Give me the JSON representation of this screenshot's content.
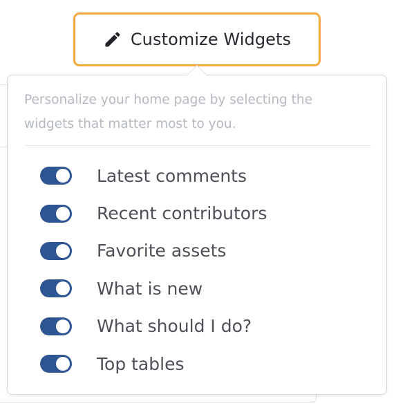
{
  "button": {
    "icon": "pencil-icon",
    "label": "Customize Widgets",
    "border_color": "#f5a83c"
  },
  "popover": {
    "description": "Personalize your home page by selecting the widgets that matter most to you.",
    "toggle_color": "#2d5592",
    "widgets": [
      {
        "label": "Latest comments",
        "enabled": true
      },
      {
        "label": "Recent contributors",
        "enabled": true
      },
      {
        "label": "Favorite assets",
        "enabled": true
      },
      {
        "label": "What is new",
        "enabled": true
      },
      {
        "label": "What should I do?",
        "enabled": true
      },
      {
        "label": "Top tables",
        "enabled": true
      }
    ]
  }
}
